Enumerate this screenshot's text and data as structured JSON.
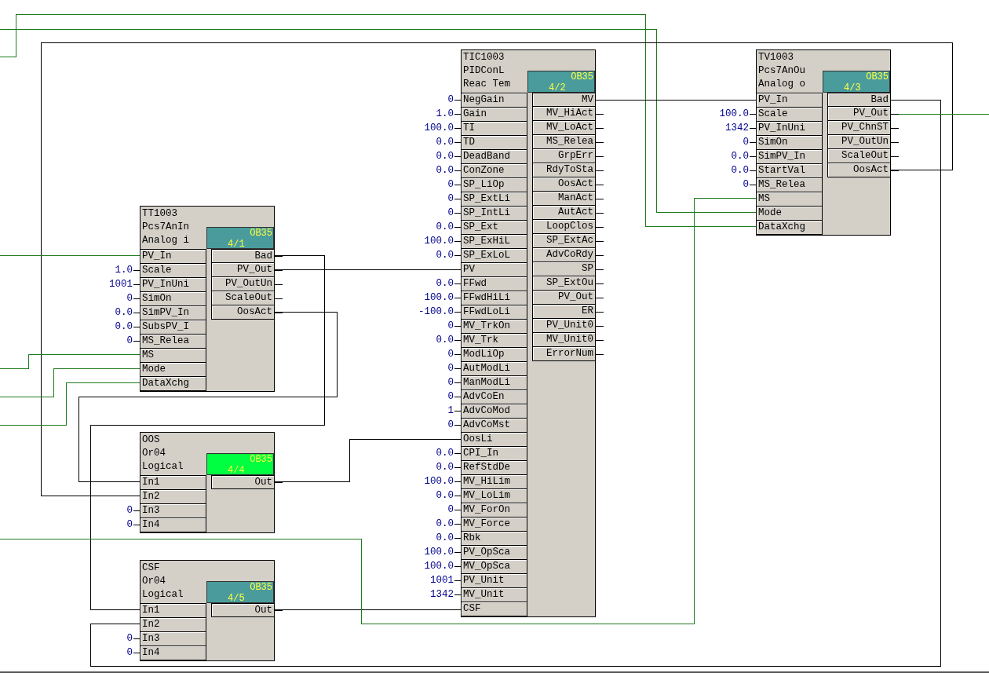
{
  "blocks": [
    {
      "name": "TIC1003",
      "type": "PIDConL",
      "comment": "Reac Tem",
      "task": "OB35",
      "sequence": "4/2",
      "color": "#4a9c9c",
      "inputs": [
        {
          "name": "NegGain",
          "value": "0"
        },
        {
          "name": "Gain",
          "value": "1.0"
        },
        {
          "name": "TI",
          "value": "100.0"
        },
        {
          "name": "TD",
          "value": "0.0"
        },
        {
          "name": "DeadBand",
          "value": "0.0"
        },
        {
          "name": "ConZone",
          "value": "0.0"
        },
        {
          "name": "SP_LiOp",
          "value": "0"
        },
        {
          "name": "SP_ExtLi",
          "value": "0"
        },
        {
          "name": "SP_IntLi",
          "value": "0"
        },
        {
          "name": "SP_Ext",
          "value": "0.0"
        },
        {
          "name": "SP_ExHiL",
          "value": "100.0"
        },
        {
          "name": "SP_ExLoL",
          "value": "0.0"
        },
        {
          "name": "PV"
        },
        {
          "name": "FFwd",
          "value": "0.0"
        },
        {
          "name": "FFwdHiLi",
          "value": "100.0"
        },
        {
          "name": "FFwdLoLi",
          "value": "-100.0"
        },
        {
          "name": "MV_TrkOn",
          "value": "0"
        },
        {
          "name": "MV_Trk",
          "value": "0.0"
        },
        {
          "name": "ModLiOp",
          "value": "0"
        },
        {
          "name": "AutModLi",
          "value": "0"
        },
        {
          "name": "ManModLi",
          "value": "0"
        },
        {
          "name": "AdvCoEn",
          "value": "0"
        },
        {
          "name": "AdvCoMod",
          "value": "1"
        },
        {
          "name": "AdvCoMst",
          "value": "0"
        },
        {
          "name": "OosLi"
        },
        {
          "name": "CPI_In",
          "value": "0.0"
        },
        {
          "name": "RefStdDe",
          "value": "0.0"
        },
        {
          "name": "MV_HiLim",
          "value": "100.0"
        },
        {
          "name": "MV_LoLim",
          "value": "0.0"
        },
        {
          "name": "MV_ForOn",
          "value": "0"
        },
        {
          "name": "MV_Force",
          "value": "0.0"
        },
        {
          "name": "Rbk",
          "value": "0.0"
        },
        {
          "name": "PV_OpSca",
          "value": "100.0"
        },
        {
          "name": "MV_OpSca",
          "value": "100.0"
        },
        {
          "name": "PV_Unit",
          "value": "1001"
        },
        {
          "name": "MV_Unit",
          "value": "1342"
        },
        {
          "name": "CSF"
        }
      ],
      "outputs": [
        "MV",
        "MV_HiAct",
        "MV_LoAct",
        "MS_Relea",
        "GrpErr",
        "RdyToSta",
        "OosAct",
        "ManAct",
        "AutAct",
        "LoopClos",
        "SP_ExtAc",
        "AdvCoRdy",
        "SP",
        "SP_ExtOu",
        "PV_Out",
        "ER",
        "PV_Unit0",
        "MV_Unit0",
        "ErrorNum"
      ]
    },
    {
      "name": "TV1003",
      "type": "Pcs7AnOu",
      "comment": "Analog o",
      "task": "OB35",
      "sequence": "4/3",
      "color": "#4a9c9c",
      "inputs": [
        {
          "name": "PV_In"
        },
        {
          "name": "Scale",
          "value": "100.0"
        },
        {
          "name": "PV_InUni",
          "value": "1342"
        },
        {
          "name": "SimOn",
          "value": "0"
        },
        {
          "name": "SimPV_In",
          "value": "0.0"
        },
        {
          "name": "StartVal",
          "value": "0.0"
        },
        {
          "name": "MS_Relea",
          "value": "0"
        },
        {
          "name": "MS"
        },
        {
          "name": "Mode"
        },
        {
          "name": "DataXchg"
        }
      ],
      "outputs": [
        "Bad",
        "PV_Out",
        "PV_ChnST",
        "PV_OutUn",
        "ScaleOut",
        "OosAct"
      ]
    },
    {
      "name": "TT1003",
      "type": "Pcs7AnIn",
      "comment": "Analog i",
      "task": "OB35",
      "sequence": "4/1",
      "color": "#4a9c9c",
      "inputs": [
        {
          "name": "PV_In"
        },
        {
          "name": "Scale",
          "value": "1.0"
        },
        {
          "name": "PV_InUni",
          "value": "1001"
        },
        {
          "name": "SimOn",
          "value": "0"
        },
        {
          "name": "SimPV_In",
          "value": "0.0"
        },
        {
          "name": "SubsPV_I",
          "value": "0.0"
        },
        {
          "name": "MS_Relea",
          "value": "0"
        },
        {
          "name": "MS"
        },
        {
          "name": "Mode"
        },
        {
          "name": "DataXchg"
        }
      ],
      "outputs": [
        "Bad",
        "PV_Out",
        "PV_OutUn",
        "ScaleOut",
        "OosAct"
      ]
    },
    {
      "name": "OOS",
      "type": "Or04",
      "comment": "Logical",
      "task": "OB35",
      "sequence": "4/4",
      "color": "#00ff40",
      "inputs": [
        {
          "name": "In1"
        },
        {
          "name": "In2"
        },
        {
          "name": "In3",
          "value": "0"
        },
        {
          "name": "In4",
          "value": "0"
        }
      ],
      "outputs": [
        "Out"
      ]
    },
    {
      "name": "CSF",
      "type": "Or04",
      "comment": "Logical",
      "task": "OB35",
      "sequence": "4/5",
      "color": "#4a9c9c",
      "inputs": [
        {
          "name": "In1"
        },
        {
          "name": "In2"
        },
        {
          "name": "In3",
          "value": "0"
        },
        {
          "name": "In4",
          "value": "0"
        }
      ],
      "outputs": [
        "Out"
      ]
    }
  ]
}
